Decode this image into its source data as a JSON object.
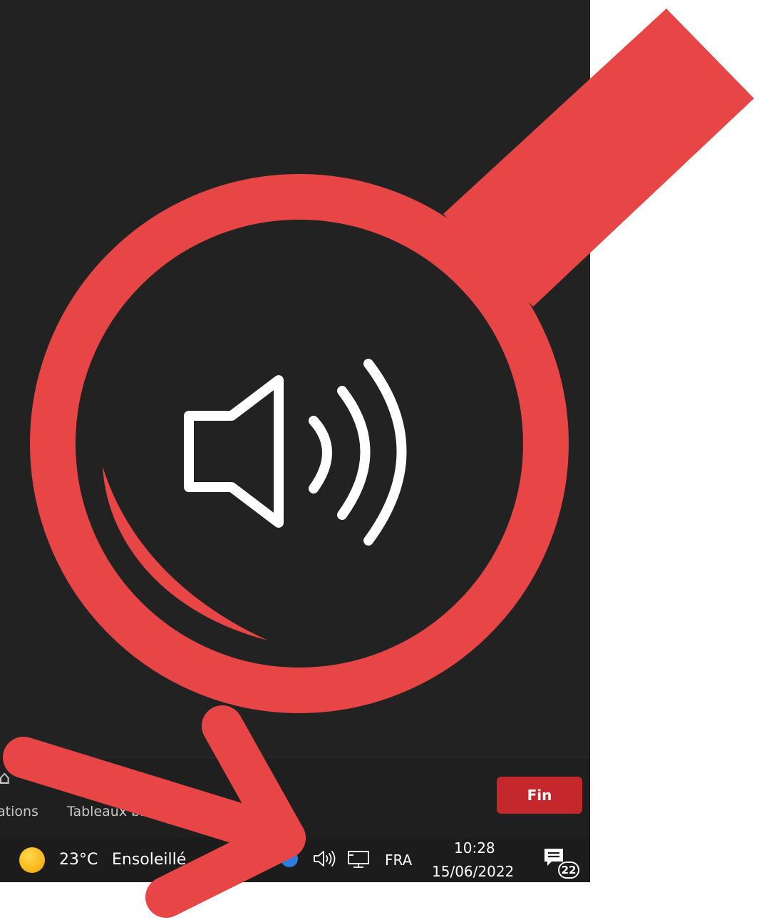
{
  "colors": {
    "accent_red": "#e84646",
    "end_button": "#c4272c",
    "panel": "#222222",
    "taskbar": "#1c1c1c"
  },
  "app_bar": {
    "tabs": [
      {
        "label": "ations",
        "icon": "bell-icon"
      },
      {
        "label": "Tableaux bla",
        "icon": "whiteboard-icon"
      }
    ],
    "end_button_label": "Fin"
  },
  "taskbar": {
    "weather": {
      "icon": "sun-icon",
      "temperature": "23°C",
      "description": "Ensoleillé"
    },
    "tray_icons": [
      "app-tray-icon",
      "volume-icon",
      "network-icon"
    ],
    "language": "FRA",
    "time": "10:28",
    "date": "15/06/2022",
    "notifications": {
      "icon": "notification-center-icon",
      "count": "22"
    }
  },
  "highlight": {
    "magnified_icon": "volume-icon",
    "pointer": "arrow-icon"
  }
}
